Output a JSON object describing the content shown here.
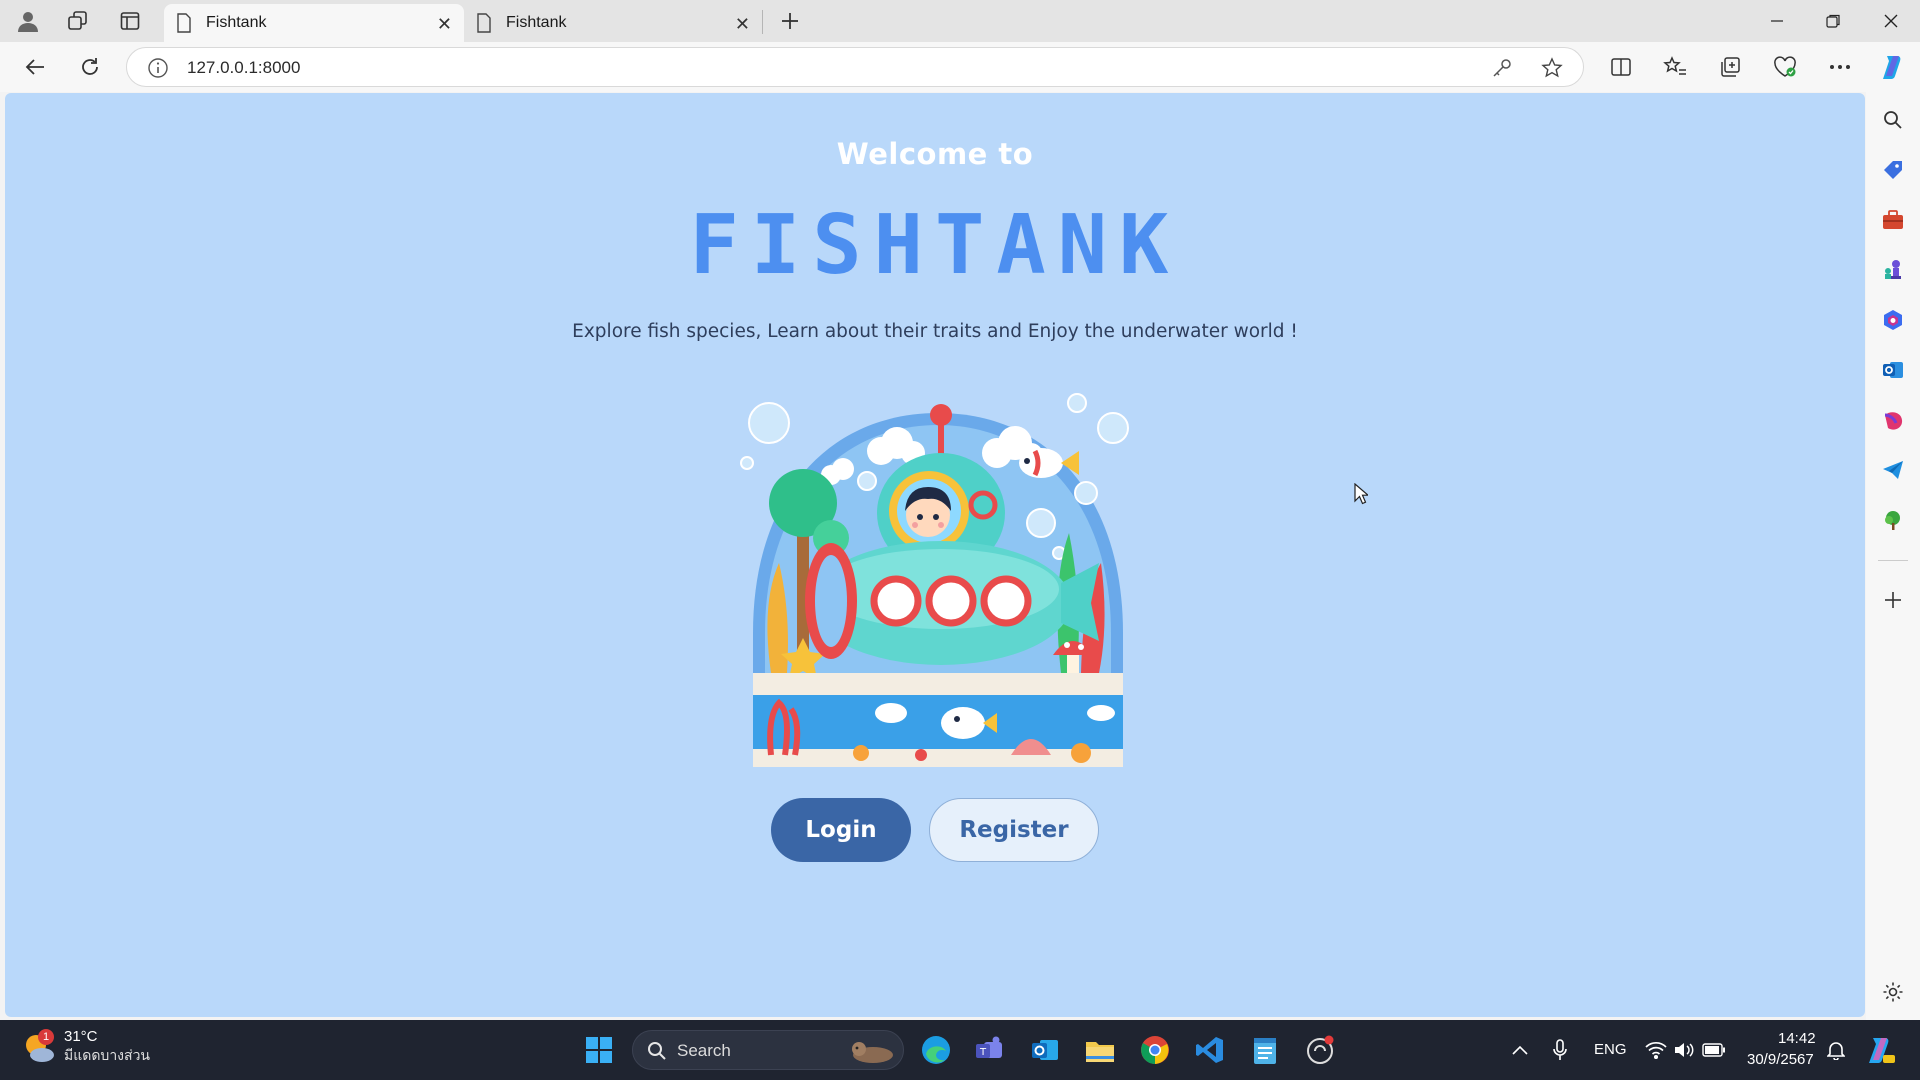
{
  "browser": {
    "tabs": [
      {
        "title": "Fishtank",
        "active": true
      },
      {
        "title": "Fishtank",
        "active": false
      }
    ],
    "address": "127.0.0.1:8000"
  },
  "page": {
    "welcome": "Welcome to",
    "logo": "FISHTANK",
    "tagline": "Explore fish species, Learn about their traits and Enjoy the underwater world !",
    "hero_image": "submarine-illustration",
    "login_label": "Login",
    "register_label": "Register"
  },
  "taskbar": {
    "weather_badge": "1",
    "temperature": "31°C",
    "condition": "มีแดดบางส่วน",
    "search_placeholder": "Search",
    "language": "ENG",
    "time": "14:42",
    "date": "30/9/2567"
  },
  "colors": {
    "page_bg": "#b9d8fa",
    "logo": "#4d8ff0",
    "login_bg": "#3a66a6",
    "register_bg": "#e6f0fb"
  }
}
